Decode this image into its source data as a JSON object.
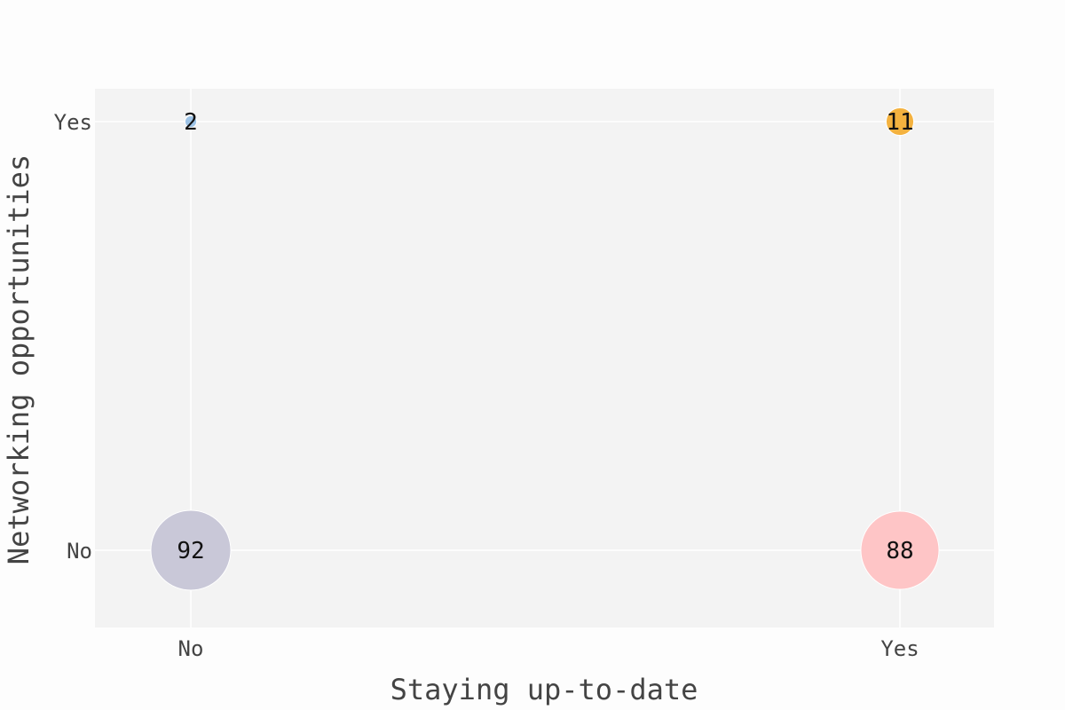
{
  "chart_data": {
    "type": "scatter",
    "subtype": "bubble",
    "xlabel": "Staying up-to-date",
    "ylabel": "Networking opportunities",
    "x_categories": [
      "No",
      "Yes"
    ],
    "y_categories": [
      "No",
      "Yes"
    ],
    "grid": true,
    "legend": "none",
    "background_color": "#f3f3f3",
    "gridline_color": "#ffffff",
    "points": [
      {
        "x": "No",
        "y": "No",
        "value": 92,
        "label": "92",
        "color": "#c9c8d8"
      },
      {
        "x": "Yes",
        "y": "No",
        "value": 88,
        "label": "88",
        "color": "#fec5c6"
      },
      {
        "x": "No",
        "y": "Yes",
        "value": 2,
        "label": "2",
        "color": "#9dc3e6"
      },
      {
        "x": "Yes",
        "y": "Yes",
        "value": 11,
        "label": "11",
        "color": "#f4b23f"
      }
    ]
  }
}
